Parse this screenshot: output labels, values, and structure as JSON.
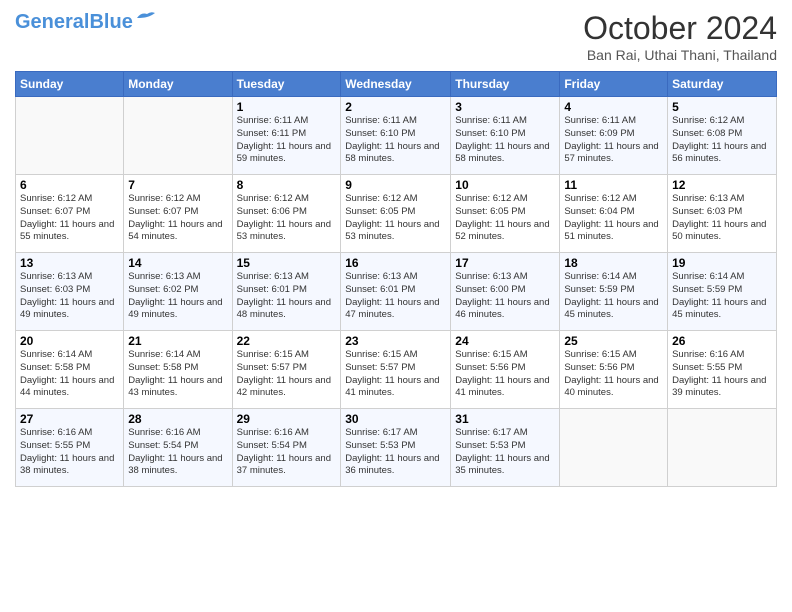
{
  "header": {
    "logo_general": "General",
    "logo_blue": "Blue",
    "month": "October 2024",
    "location": "Ban Rai, Uthai Thani, Thailand"
  },
  "days_of_week": [
    "Sunday",
    "Monday",
    "Tuesday",
    "Wednesday",
    "Thursday",
    "Friday",
    "Saturday"
  ],
  "weeks": [
    [
      {
        "day": "",
        "info": ""
      },
      {
        "day": "",
        "info": ""
      },
      {
        "day": "1",
        "info": "Sunrise: 6:11 AM\nSunset: 6:11 PM\nDaylight: 11 hours and 59 minutes."
      },
      {
        "day": "2",
        "info": "Sunrise: 6:11 AM\nSunset: 6:10 PM\nDaylight: 11 hours and 58 minutes."
      },
      {
        "day": "3",
        "info": "Sunrise: 6:11 AM\nSunset: 6:10 PM\nDaylight: 11 hours and 58 minutes."
      },
      {
        "day": "4",
        "info": "Sunrise: 6:11 AM\nSunset: 6:09 PM\nDaylight: 11 hours and 57 minutes."
      },
      {
        "day": "5",
        "info": "Sunrise: 6:12 AM\nSunset: 6:08 PM\nDaylight: 11 hours and 56 minutes."
      }
    ],
    [
      {
        "day": "6",
        "info": "Sunrise: 6:12 AM\nSunset: 6:07 PM\nDaylight: 11 hours and 55 minutes."
      },
      {
        "day": "7",
        "info": "Sunrise: 6:12 AM\nSunset: 6:07 PM\nDaylight: 11 hours and 54 minutes."
      },
      {
        "day": "8",
        "info": "Sunrise: 6:12 AM\nSunset: 6:06 PM\nDaylight: 11 hours and 53 minutes."
      },
      {
        "day": "9",
        "info": "Sunrise: 6:12 AM\nSunset: 6:05 PM\nDaylight: 11 hours and 53 minutes."
      },
      {
        "day": "10",
        "info": "Sunrise: 6:12 AM\nSunset: 6:05 PM\nDaylight: 11 hours and 52 minutes."
      },
      {
        "day": "11",
        "info": "Sunrise: 6:12 AM\nSunset: 6:04 PM\nDaylight: 11 hours and 51 minutes."
      },
      {
        "day": "12",
        "info": "Sunrise: 6:13 AM\nSunset: 6:03 PM\nDaylight: 11 hours and 50 minutes."
      }
    ],
    [
      {
        "day": "13",
        "info": "Sunrise: 6:13 AM\nSunset: 6:03 PM\nDaylight: 11 hours and 49 minutes."
      },
      {
        "day": "14",
        "info": "Sunrise: 6:13 AM\nSunset: 6:02 PM\nDaylight: 11 hours and 49 minutes."
      },
      {
        "day": "15",
        "info": "Sunrise: 6:13 AM\nSunset: 6:01 PM\nDaylight: 11 hours and 48 minutes."
      },
      {
        "day": "16",
        "info": "Sunrise: 6:13 AM\nSunset: 6:01 PM\nDaylight: 11 hours and 47 minutes."
      },
      {
        "day": "17",
        "info": "Sunrise: 6:13 AM\nSunset: 6:00 PM\nDaylight: 11 hours and 46 minutes."
      },
      {
        "day": "18",
        "info": "Sunrise: 6:14 AM\nSunset: 5:59 PM\nDaylight: 11 hours and 45 minutes."
      },
      {
        "day": "19",
        "info": "Sunrise: 6:14 AM\nSunset: 5:59 PM\nDaylight: 11 hours and 45 minutes."
      }
    ],
    [
      {
        "day": "20",
        "info": "Sunrise: 6:14 AM\nSunset: 5:58 PM\nDaylight: 11 hours and 44 minutes."
      },
      {
        "day": "21",
        "info": "Sunrise: 6:14 AM\nSunset: 5:58 PM\nDaylight: 11 hours and 43 minutes."
      },
      {
        "day": "22",
        "info": "Sunrise: 6:15 AM\nSunset: 5:57 PM\nDaylight: 11 hours and 42 minutes."
      },
      {
        "day": "23",
        "info": "Sunrise: 6:15 AM\nSunset: 5:57 PM\nDaylight: 11 hours and 41 minutes."
      },
      {
        "day": "24",
        "info": "Sunrise: 6:15 AM\nSunset: 5:56 PM\nDaylight: 11 hours and 41 minutes."
      },
      {
        "day": "25",
        "info": "Sunrise: 6:15 AM\nSunset: 5:56 PM\nDaylight: 11 hours and 40 minutes."
      },
      {
        "day": "26",
        "info": "Sunrise: 6:16 AM\nSunset: 5:55 PM\nDaylight: 11 hours and 39 minutes."
      }
    ],
    [
      {
        "day": "27",
        "info": "Sunrise: 6:16 AM\nSunset: 5:55 PM\nDaylight: 11 hours and 38 minutes."
      },
      {
        "day": "28",
        "info": "Sunrise: 6:16 AM\nSunset: 5:54 PM\nDaylight: 11 hours and 38 minutes."
      },
      {
        "day": "29",
        "info": "Sunrise: 6:16 AM\nSunset: 5:54 PM\nDaylight: 11 hours and 37 minutes."
      },
      {
        "day": "30",
        "info": "Sunrise: 6:17 AM\nSunset: 5:53 PM\nDaylight: 11 hours and 36 minutes."
      },
      {
        "day": "31",
        "info": "Sunrise: 6:17 AM\nSunset: 5:53 PM\nDaylight: 11 hours and 35 minutes."
      },
      {
        "day": "",
        "info": ""
      },
      {
        "day": "",
        "info": ""
      }
    ]
  ]
}
